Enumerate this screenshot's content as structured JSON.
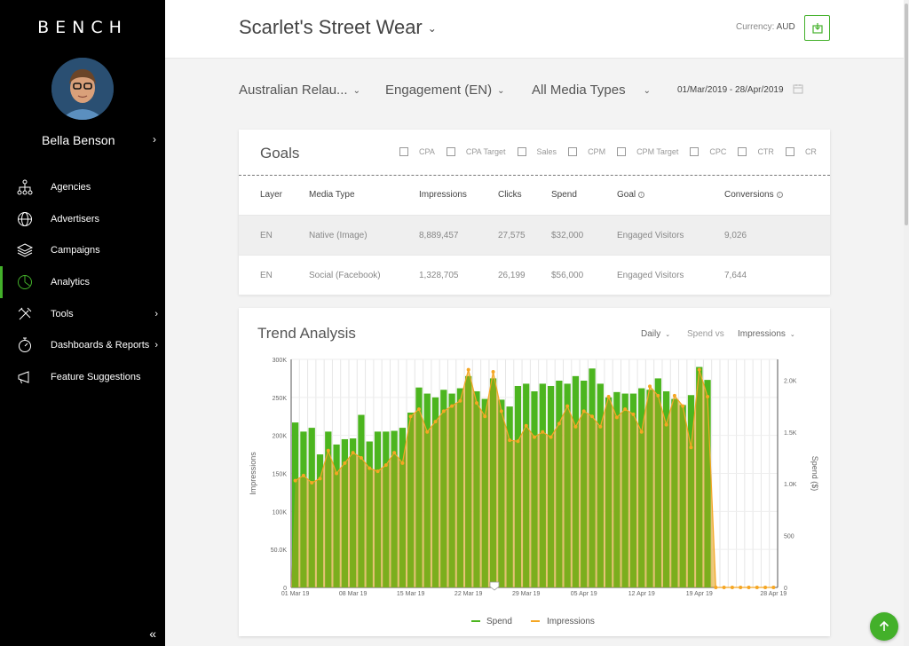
{
  "brand": {
    "logo": "BENCH",
    "accent": "#43b02a",
    "impressions_color": "#f5a623"
  },
  "user": {
    "name": "Bella Benson"
  },
  "nav": [
    {
      "label": "Agencies",
      "icon": "hierarchy-icon",
      "has_submenu": false
    },
    {
      "label": "Advertisers",
      "icon": "globe-icon",
      "has_submenu": false
    },
    {
      "label": "Campaigns",
      "icon": "layers-icon",
      "has_submenu": false
    },
    {
      "label": "Analytics",
      "icon": "analytics-icon",
      "has_submenu": false,
      "active": true
    },
    {
      "label": "Tools",
      "icon": "tools-icon",
      "has_submenu": true
    },
    {
      "label": "Dashboards & Reports",
      "icon": "stopwatch-icon",
      "has_submenu": true
    },
    {
      "label": "Feature Suggestions",
      "icon": "megaphone-icon",
      "has_submenu": false
    }
  ],
  "header": {
    "client": "Scarlet's Street Wear",
    "currency_label": "Currency:",
    "currency_value": "AUD"
  },
  "filters": {
    "campaign": "Australian Relau...",
    "kpi": "Engagement (EN)",
    "media": "All Media Types",
    "date_range": "01/Mar/2019 - 28/Apr/2019"
  },
  "goals": {
    "title": "Goals",
    "options": [
      "CPA",
      "CPA Target",
      "Sales",
      "CPM",
      "CPM Target",
      "CPC",
      "CTR",
      "CR"
    ],
    "columns": [
      "Layer",
      "Media Type",
      "Impressions",
      "Clicks",
      "Spend",
      "Goal",
      "Conversions"
    ],
    "rows": [
      {
        "layer": "EN",
        "media_type": "Native (Image)",
        "impressions": "8,889,457",
        "clicks": "27,575",
        "spend": "$32,000",
        "goal": "Engaged Visitors",
        "conversions": "9,026"
      },
      {
        "layer": "EN",
        "media_type": "Social (Facebook)",
        "impressions": "1,328,705",
        "clicks": "26,199",
        "spend": "$56,000",
        "goal": "Engaged Visitors",
        "conversions": "7,644"
      }
    ]
  },
  "trend": {
    "title": "Trend Analysis",
    "granularity": "Daily",
    "metric_a": "Spend vs",
    "metric_b": "Impressions"
  },
  "chart_data": {
    "type": "bar",
    "ylabel_left": "Impressions",
    "ylabel_right": "Spend ($)",
    "y_left_ticks": [
      "0",
      "50.0K",
      "100K",
      "150K",
      "200K",
      "250K",
      "300K"
    ],
    "y_left_lim": [
      0,
      300000
    ],
    "y_right_ticks": [
      "0",
      "500",
      "1.0K",
      "1.5K",
      "2.0K"
    ],
    "y_right_lim": [
      0,
      2200
    ],
    "x_ticks": [
      "01 Mar 19",
      "08 Mar 19",
      "15 Mar 19",
      "22 Mar 19",
      "29 Mar 19",
      "05 Apr 19",
      "12 Apr 19",
      "19 Apr 19",
      "28 Apr 19"
    ],
    "x_start": "01 Mar 19",
    "x_end": "28 Apr 19",
    "grid": true,
    "legend_position": "bottom",
    "series": [
      {
        "name": "Spend",
        "axis": "left",
        "values": [
          217000,
          205000,
          210000,
          175000,
          205000,
          188000,
          195000,
          196000,
          227000,
          192000,
          205000,
          205000,
          206000,
          210000,
          230000,
          263000,
          255000,
          250000,
          260000,
          255000,
          262000,
          278000,
          258000,
          248000,
          275000,
          247000,
          238000,
          265000,
          268000,
          258000,
          268000,
          265000,
          272000,
          268000,
          278000,
          272000,
          288000,
          268000,
          250000,
          257000,
          255000,
          255000,
          262000,
          260000,
          275000,
          258000,
          248000,
          240000,
          253000,
          290000,
          273000,
          0,
          0,
          0,
          0,
          0,
          0,
          0,
          0
        ]
      },
      {
        "name": "Impressions",
        "axis": "right",
        "values": [
          1030,
          1080,
          1010,
          1050,
          1320,
          1100,
          1200,
          1300,
          1250,
          1150,
          1120,
          1180,
          1300,
          1200,
          1650,
          1720,
          1500,
          1600,
          1700,
          1750,
          1800,
          2100,
          1780,
          1650,
          2080,
          1700,
          1420,
          1410,
          1560,
          1450,
          1500,
          1450,
          1580,
          1750,
          1550,
          1700,
          1650,
          1550,
          1840,
          1640,
          1720,
          1670,
          1500,
          1940,
          1850,
          1570,
          1850,
          1750,
          1350,
          2100,
          1840,
          0,
          0,
          0,
          0,
          0,
          0,
          0,
          0
        ]
      }
    ]
  },
  "legend": {
    "spend": "Spend",
    "impressions": "Impressions"
  }
}
